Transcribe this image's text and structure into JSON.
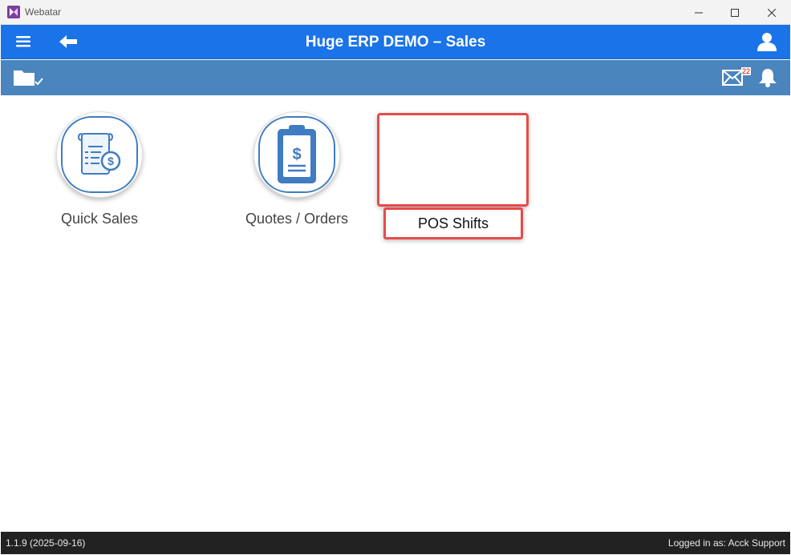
{
  "window": {
    "title": "Webatar",
    "controls": [
      "minimize-icon",
      "maximize-icon",
      "close-icon"
    ]
  },
  "header": {
    "title": "Huge ERP DEMO – Sales",
    "left_icons": [
      "hamburger-menu-icon",
      "back-arrow-icon"
    ],
    "right_icons": [
      "user-icon"
    ],
    "color": "#1a73e8"
  },
  "toolbar": {
    "left_icon": "folder-check-icon",
    "mail_icon": "mail-icon",
    "mail_count": "22",
    "bell_icon": "bell-icon",
    "color": "#4a85bd"
  },
  "tiles": [
    {
      "label": "Quick Sales",
      "icon": "invoice-dollar-icon"
    },
    {
      "label": "Quotes / Orders",
      "icon": "clipboard-dollar-icon"
    },
    {
      "label": "POS Shifts",
      "icon": "",
      "highlighted": true
    }
  ],
  "footer": {
    "version": "1.1.9 (2025-09-16)",
    "logged_in": "Logged in as: Acck Support"
  },
  "colors": {
    "highlight": "#e84a4a",
    "footer_bg": "#222222",
    "icon_blue": "#3f7cc1"
  }
}
